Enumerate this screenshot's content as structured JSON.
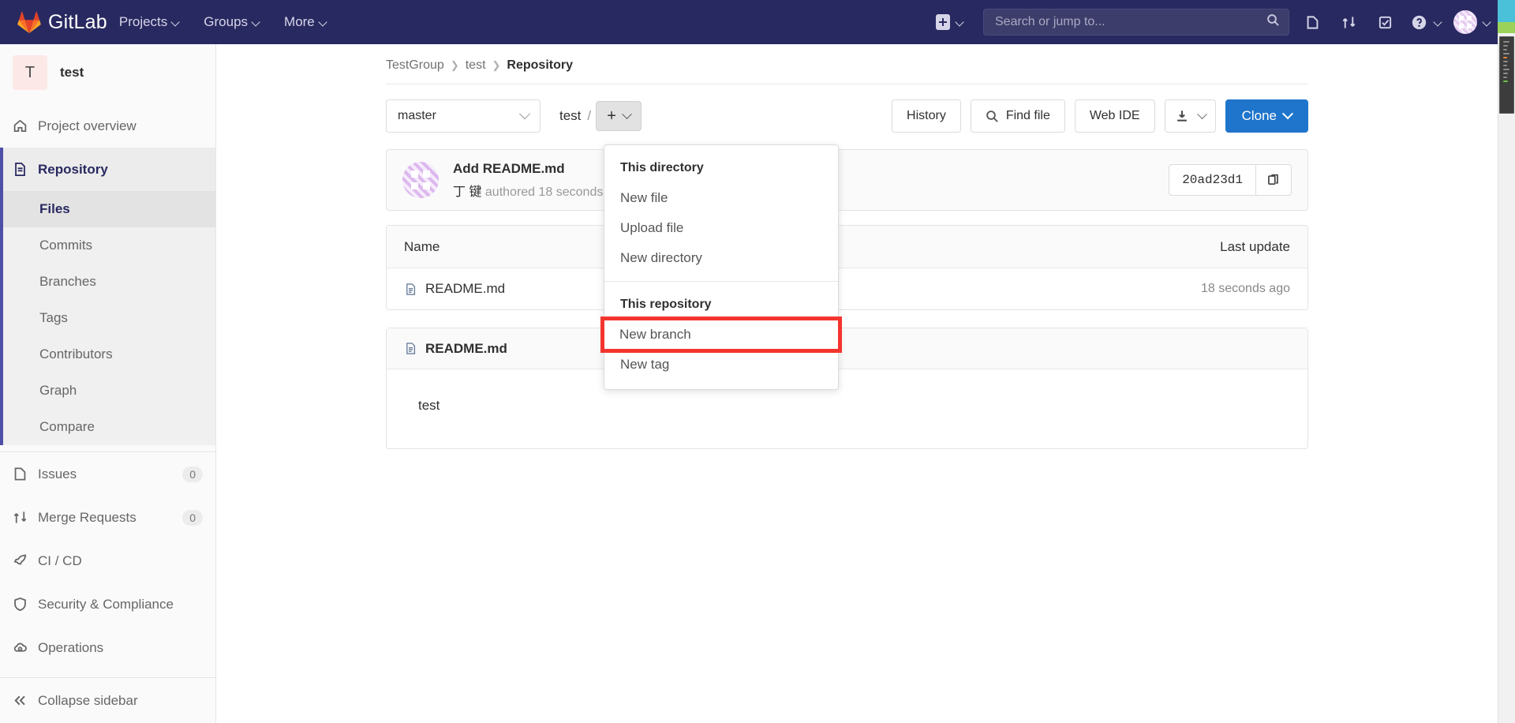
{
  "navbar": {
    "brand": "GitLab",
    "menu": [
      {
        "label": "Projects",
        "icon": "chevron-down-icon"
      },
      {
        "label": "Groups",
        "icon": "chevron-down-icon"
      },
      {
        "label": "More",
        "icon": "chevron-down-icon"
      }
    ],
    "create_new_label": "+",
    "search_placeholder": "Search or jump to...",
    "icons": [
      "search-icon",
      "issues-icon",
      "merge-requests-icon",
      "todos-icon",
      "help-icon",
      "user-avatar"
    ],
    "accent_bg": "#292961"
  },
  "sidebar": {
    "project_initial": "T",
    "project_name": "test",
    "items": [
      {
        "label": "Project overview",
        "icon": "home-icon",
        "badge": ""
      },
      {
        "label": "Repository",
        "icon": "document-icon",
        "badge": "",
        "active": true
      },
      {
        "label": "Issues",
        "icon": "issues-icon",
        "badge": "0"
      },
      {
        "label": "Merge Requests",
        "icon": "merge-requests-icon",
        "badge": "0"
      },
      {
        "label": "CI / CD",
        "icon": "rocket-icon",
        "badge": ""
      },
      {
        "label": "Security & Compliance",
        "icon": "shield-icon",
        "badge": ""
      },
      {
        "label": "Operations",
        "icon": "cloud-gear-icon",
        "badge": ""
      }
    ],
    "sub_items": [
      {
        "label": "Files",
        "current": true
      },
      {
        "label": "Commits"
      },
      {
        "label": "Branches"
      },
      {
        "label": "Tags"
      },
      {
        "label": "Contributors"
      },
      {
        "label": "Graph"
      },
      {
        "label": "Compare"
      }
    ],
    "collapse_label": "Collapse sidebar",
    "collapse_icon": "double-chevron-left-icon"
  },
  "breadcrumb": {
    "group": "TestGroup",
    "project": "test",
    "section": "Repository"
  },
  "toolbar": {
    "branch": "master",
    "path_root": "test",
    "path_sep": "/",
    "add_label": "+",
    "history_label": "History",
    "find_file_label": "Find file",
    "web_ide_label": "Web IDE",
    "download_icon": "download-icon",
    "clone_label": "Clone",
    "clone_color": "#1f75cb"
  },
  "dropdown": {
    "groups": [
      {
        "header": "This directory",
        "items": [
          {
            "label": "New file",
            "highlight": false
          },
          {
            "label": "Upload file",
            "highlight": false
          },
          {
            "label": "New directory",
            "highlight": false
          }
        ]
      },
      {
        "header": "This repository",
        "items": [
          {
            "label": "New branch",
            "highlight": true
          },
          {
            "label": "New tag",
            "highlight": false
          }
        ]
      }
    ],
    "highlight_color": "#f4352e"
  },
  "commit": {
    "title": "Add README.md",
    "author": "丁 键",
    "meta": "authored 18 seconds ago",
    "sha": "20ad23d1",
    "copy_icon": "clipboard-icon",
    "avatar_icon": "identicon-avatar"
  },
  "files_table": {
    "headers": {
      "name": "Name",
      "last_update": "Last update"
    },
    "rows": [
      {
        "name": "README.md",
        "icon": "file-icon",
        "last_update": "18 seconds ago"
      }
    ]
  },
  "readme": {
    "title": "README.md",
    "icon": "file-icon",
    "body": "test"
  }
}
